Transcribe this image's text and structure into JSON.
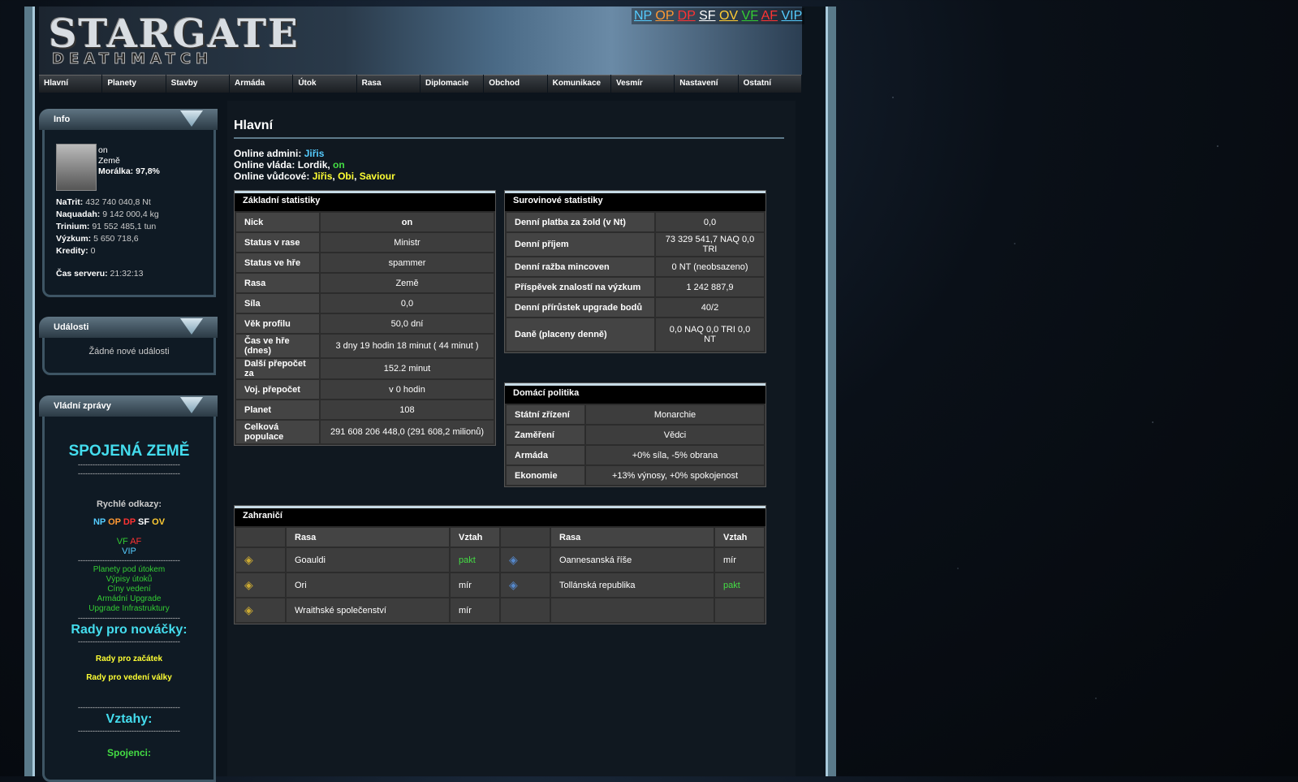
{
  "colors": {
    "np": "#55ccff",
    "op": "#ff9933",
    "dp": "#ff3333",
    "sf": "#ffffff",
    "ov": "#ffcc33",
    "vf": "#33cc33",
    "af": "#ff3333",
    "vip": "#55ccff",
    "link_yellow": "#ffff33",
    "link_blue": "#55ccff",
    "link_green": "#44dd44",
    "teal": "#44ddee"
  },
  "header": {
    "logo": "STARGATE",
    "logo_sub": "DEATHMATCH",
    "quick": [
      {
        "label": "NP",
        "c": "np"
      },
      {
        "label": "OP",
        "c": "op"
      },
      {
        "label": "DP",
        "c": "dp"
      },
      {
        "label": "SF",
        "c": "sf"
      },
      {
        "label": "OV",
        "c": "ov"
      },
      {
        "label": "VF",
        "c": "vf"
      },
      {
        "label": "AF",
        "c": "af"
      },
      {
        "label": "VIP",
        "c": "vip"
      }
    ]
  },
  "nav": [
    "Hlavní",
    "Planety",
    "Stavby",
    "Armáda",
    "Útok",
    "Rasa",
    "Diplomacie",
    "Obchod",
    "Komunikace",
    "Vesmír",
    "Nastavení",
    "Ostatní"
  ],
  "info": {
    "title": "Info",
    "nick": "on",
    "race": "Země",
    "morale_label": "Morálka:",
    "morale": "97,8%",
    "resources": [
      {
        "k": "NaTrit:",
        "v": "432 740 040,8 Nt"
      },
      {
        "k": "Naquadah:",
        "v": "9 142 000,4 kg"
      },
      {
        "k": "Trinium:",
        "v": "91 552 485,1 tun"
      },
      {
        "k": "Výzkum:",
        "v": "5 650 718,6"
      },
      {
        "k": "Kredity:",
        "v": "0"
      }
    ],
    "time_label": "Čas serveru:",
    "time": "21:32:13"
  },
  "events": {
    "title": "Události",
    "text": "Žádné nové události"
  },
  "gov": {
    "title": "Vládní zprávy",
    "heading": "SPOJENÁ ZEMĚ",
    "dash": "------------------------------------------",
    "quick_label": "Rychlé odkazy:",
    "links": [
      "Planety pod útokem",
      "Výpisy útoků",
      "Cíny vedení",
      "Armádní Upgrade",
      "Upgrade Infrastruktury"
    ],
    "novice": "Rady pro nováčky:",
    "novice_links": [
      "Rady pro začátek",
      "Rady pro vedení války"
    ],
    "relations": "Vztahy:",
    "allies": "Spojenci:"
  },
  "main": {
    "title": "Hlavní",
    "online_admin_label": "Online admini:",
    "online_admin": "Jiřis",
    "online_gov_label": "Online vláda:",
    "online_gov": [
      "Lordik",
      "on"
    ],
    "online_lead_label": "Online vůdcové:",
    "online_lead": [
      "Jiřis",
      "Obi",
      "Saviour"
    ]
  },
  "basic": {
    "title": "Základní statistiky",
    "rows": [
      {
        "k": "Nick",
        "v": "on"
      },
      {
        "k": "Status v rase",
        "v": "Ministr"
      },
      {
        "k": "Status ve hře",
        "v": "spammer"
      },
      {
        "k": "Rasa",
        "v": "Země"
      },
      {
        "k": "Síla",
        "v": "0,0"
      },
      {
        "k": "Věk profilu",
        "v": "50,0 dní"
      },
      {
        "k": "Čas ve hře (dnes)",
        "v": "3 dny 19 hodin 18 minut ( 44 minut )"
      },
      {
        "k": "Další přepočet za",
        "v": "152.2 minut"
      },
      {
        "k": "Voj. přepočet",
        "v": "v 0 hodin"
      },
      {
        "k": "Planet",
        "v": "108"
      },
      {
        "k": "Celková populace",
        "v": "291 608 206 448,0 (291 608,2 milionů)"
      }
    ]
  },
  "resource": {
    "title": "Surovinové statistiky",
    "rows": [
      {
        "k": "Denní platba za žold (v Nt)",
        "v": "0,0"
      },
      {
        "k": "Denní příjem",
        "v": "73 329 541,7 NAQ 0,0 TRI"
      },
      {
        "k": "Denní ražba mincoven",
        "v": "0 NT (neobsazeno)"
      },
      {
        "k": "Příspěvek znalostí na výzkum",
        "v": "1 242 887,9"
      },
      {
        "k": "Denní přírůstek upgrade bodů",
        "v": "40/2"
      },
      {
        "k": "Daně (placeny denně)",
        "v": "0,0 NAQ 0,0 TRI 0,0 NT"
      }
    ]
  },
  "domestic": {
    "title": "Domácí politika",
    "rows": [
      {
        "k": "Státní zřízení",
        "v": "Monarchie"
      },
      {
        "k": "Zaměření",
        "v": "Vědci"
      },
      {
        "k": "Armáda",
        "v": "+0% síla, -5% obrana"
      },
      {
        "k": "Ekonomie",
        "v": "+13% výnosy, +0% spokojenost"
      }
    ]
  },
  "foreign": {
    "title": "Zahraničí",
    "h_race": "Rasa",
    "h_rel": "Vztah",
    "rows": [
      [
        {
          "race": "Goauldi",
          "rel": "pakt",
          "green": true
        },
        {
          "race": "Oannesanská říše",
          "rel": "mír",
          "green": false
        }
      ],
      [
        {
          "race": "Ori",
          "rel": "mír",
          "green": false
        },
        {
          "race": "Tollánská republika",
          "rel": "pakt",
          "green": true
        }
      ],
      [
        {
          "race": "Wraithské společenství",
          "rel": "mír",
          "green": false
        },
        {
          "race": "",
          "rel": "",
          "green": false
        }
      ]
    ]
  }
}
